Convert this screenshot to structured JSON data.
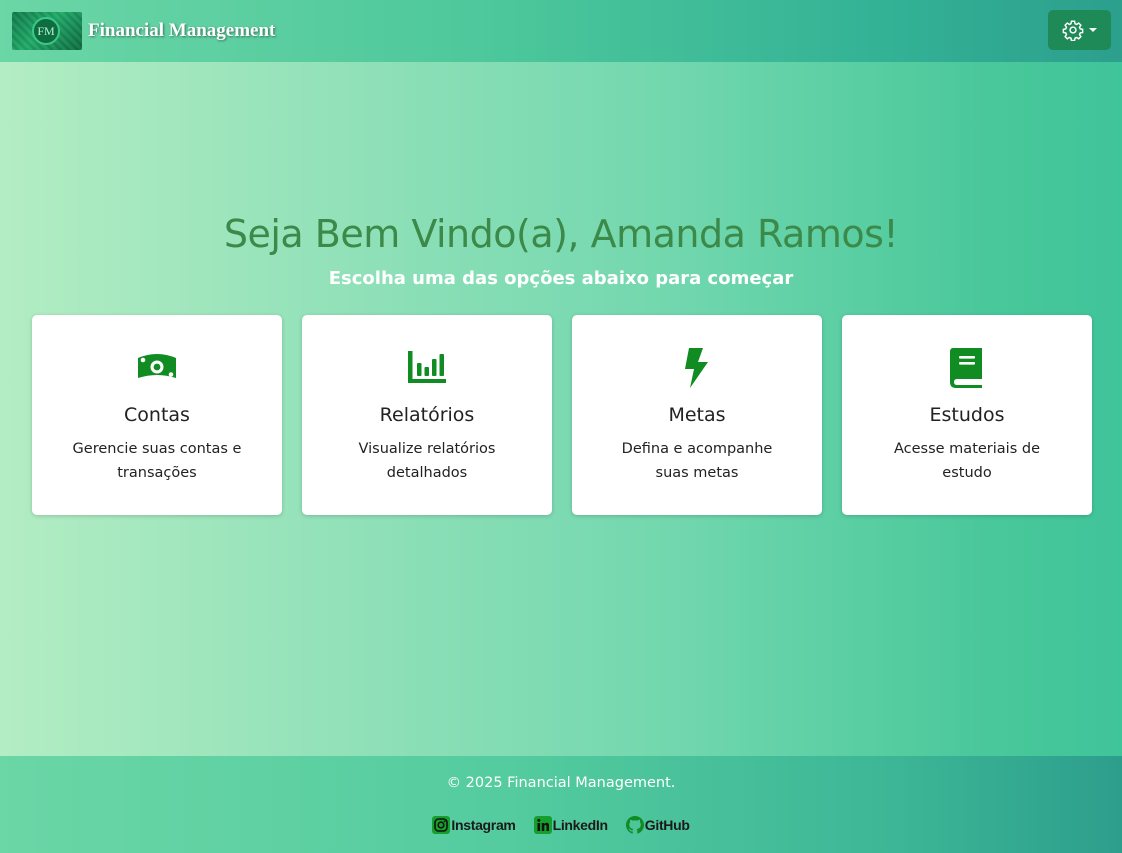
{
  "header": {
    "logo_text": "FM",
    "brand_name": "Financial Management",
    "settings_icon": "gear-icon"
  },
  "main": {
    "welcome": "Seja Bem Vindo(a), Amanda Ramos!",
    "subtitle": "Escolha uma das opções abaixo para começar",
    "cards": [
      {
        "icon": "money-bill-icon",
        "title": "Contas",
        "description": "Gerencie suas contas e transações"
      },
      {
        "icon": "chart-bar-icon",
        "title": "Relatórios",
        "description": "Visualize relatórios detalhados"
      },
      {
        "icon": "bolt-icon",
        "title": "Metas",
        "description": "Defina e acompanhe suas metas"
      },
      {
        "icon": "book-icon",
        "title": "Estudos",
        "description": "Acesse materiais de estudo"
      }
    ]
  },
  "footer": {
    "copyright": "© 2025 Financial Management.",
    "links": [
      {
        "icon": "instagram-icon",
        "label": "Instagram"
      },
      {
        "icon": "linkedin-icon",
        "label": "LinkedIn"
      },
      {
        "icon": "github-icon",
        "label": "GitHub"
      }
    ]
  },
  "colors": {
    "accent_green": "#108c23",
    "welcome_text": "#3c8a49",
    "settings_button": "#1e8a57"
  }
}
